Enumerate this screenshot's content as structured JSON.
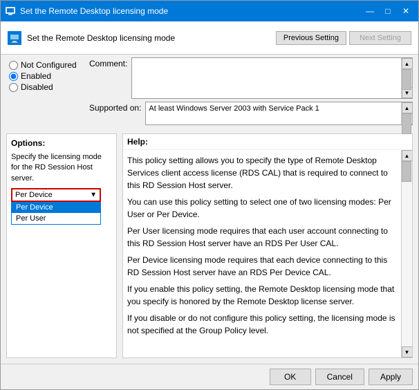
{
  "window": {
    "title": "Set the Remote Desktop licensing mode",
    "icon": "🖥"
  },
  "titlebar": {
    "minimize_label": "—",
    "maximize_label": "□",
    "close_label": "✕"
  },
  "header": {
    "icon": "🖥",
    "title": "Set the Remote Desktop licensing mode",
    "prev_button": "Previous Setting",
    "next_button": "Next Setting"
  },
  "radio": {
    "not_configured": "Not Configured",
    "enabled": "Enabled",
    "disabled": "Disabled"
  },
  "comment": {
    "label": "Comment:",
    "placeholder": ""
  },
  "supported": {
    "label": "Supported on:",
    "value": "At least Windows Server 2003 with Service Pack 1"
  },
  "options": {
    "title": "Options:",
    "description": "Specify the licensing mode for the RD Session Host server.",
    "dropdown_selected": "Per Device",
    "dropdown_items": [
      "Per Device",
      "Per User"
    ]
  },
  "help": {
    "title": "Help:",
    "paragraphs": [
      "This policy setting allows you to specify the type of Remote Desktop Services client access license (RDS CAL) that is required to connect to this RD Session Host server.",
      "You can use this policy setting to select one of two licensing modes: Per User or Per Device.",
      "Per User licensing mode requires that each user account connecting to this RD Session Host server have an RDS Per User CAL.",
      "Per Device licensing mode requires that each device connecting to this RD Session Host server have an RDS Per Device CAL.",
      "If you enable this policy setting, the Remote Desktop licensing mode that you specify is honored by the Remote Desktop license server.",
      "If you disable or do not configure this policy setting, the licensing mode is not specified at the Group Policy level."
    ]
  },
  "footer": {
    "ok": "OK",
    "cancel": "Cancel",
    "apply": "Apply"
  }
}
